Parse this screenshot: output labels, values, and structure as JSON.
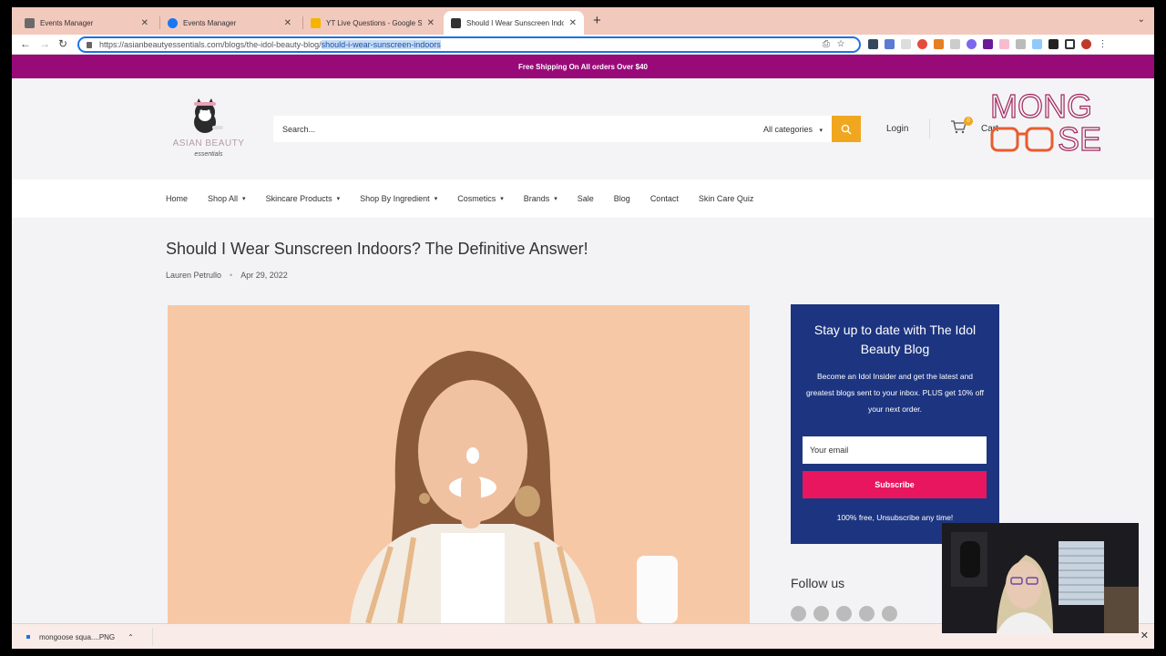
{
  "browser": {
    "tabs": [
      {
        "title": "Events Manager",
        "favicon_color": "#6a6a6a",
        "active": false
      },
      {
        "title": "Events Manager",
        "favicon_color": "#1877f2",
        "active": false
      },
      {
        "title": "YT Live Questions - Google Sl",
        "favicon_color": "#f4b400",
        "active": false
      },
      {
        "title": "Should I Wear Sunscreen Indoo",
        "favicon_color": "#333333",
        "active": true
      }
    ],
    "url_base": "https://asianbeautyessentials.com/blogs/the-idol-beauty-blog/",
    "url_selected": "should-i-wear-sunscreen-indoors"
  },
  "site": {
    "promo": "Free Shipping On All orders Over $40",
    "logo_name": "ASIAN BEAUTY",
    "logo_sub": "essentials",
    "search_placeholder": "Search...",
    "category": "All categories",
    "login": "Login",
    "cart_count": "0",
    "cart_label": "Cart",
    "nav": [
      {
        "label": "Home",
        "dropdown": false
      },
      {
        "label": "Shop All",
        "dropdown": true
      },
      {
        "label": "Skincare Products",
        "dropdown": true
      },
      {
        "label": "Shop By Ingredient",
        "dropdown": true
      },
      {
        "label": "Cosmetics",
        "dropdown": true
      },
      {
        "label": "Brands",
        "dropdown": true
      },
      {
        "label": "Sale",
        "dropdown": false
      },
      {
        "label": "Blog",
        "dropdown": false
      },
      {
        "label": "Contact",
        "dropdown": false
      },
      {
        "label": "Skin Care Quiz",
        "dropdown": false
      }
    ]
  },
  "article": {
    "title": "Should I Wear Sunscreen Indoors? The Definitive Answer!",
    "author": "Lauren Petrullo",
    "date": "Apr 29, 2022"
  },
  "newsletter": {
    "title": "Stay up to date with The Idol Beauty Blog",
    "desc": "Become an Idol Insider and get the latest and greatest blogs sent to your inbox. PLUS get 10% off your next order.",
    "email_placeholder": "Your email",
    "button": "Subscribe",
    "footnote": "100% free, Unsubscribe any time!"
  },
  "follow": "Follow us",
  "watermark": "MONGOOSE",
  "download": {
    "filename": "mongoose squa....PNG"
  },
  "colors": {
    "promo": "#990a79",
    "search_btn": "#f0a71f",
    "newsletter_bg": "#1d3580",
    "subscribe": "#e8165f",
    "watermark": "#a2285f"
  }
}
